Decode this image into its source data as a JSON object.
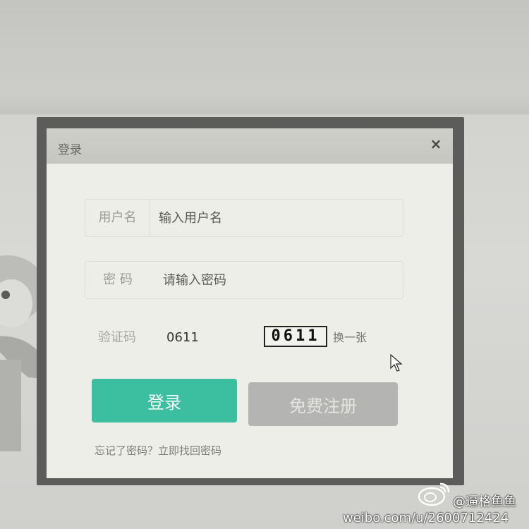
{
  "dialog": {
    "title": "登录",
    "close_symbol": "×"
  },
  "username": {
    "label": "用户名",
    "placeholder": "输入用户名",
    "value": ""
  },
  "password": {
    "label": "密 码",
    "placeholder": "请输入密码",
    "value": ""
  },
  "captcha": {
    "label": "验证码",
    "value": "0611",
    "image_text": "0611",
    "refresh_label": "换一张"
  },
  "buttons": {
    "login_label": "登录",
    "register_label": "免费注册"
  },
  "forgot_link": "忘记了密码？立即找回密码",
  "watermark": {
    "user": "@逼格鱼鱼",
    "url": "weibo.com/u/2600712424"
  },
  "colors": {
    "login_button": "#3cbfa0",
    "register_button": "#b4b5b2",
    "dialog_bg": "#eeeee8",
    "titlebar_bg": "#c9c9c4"
  },
  "icons": {
    "close": "close-icon",
    "cursor": "mouse-pointer-icon",
    "weibo": "weibo-logo-icon"
  }
}
